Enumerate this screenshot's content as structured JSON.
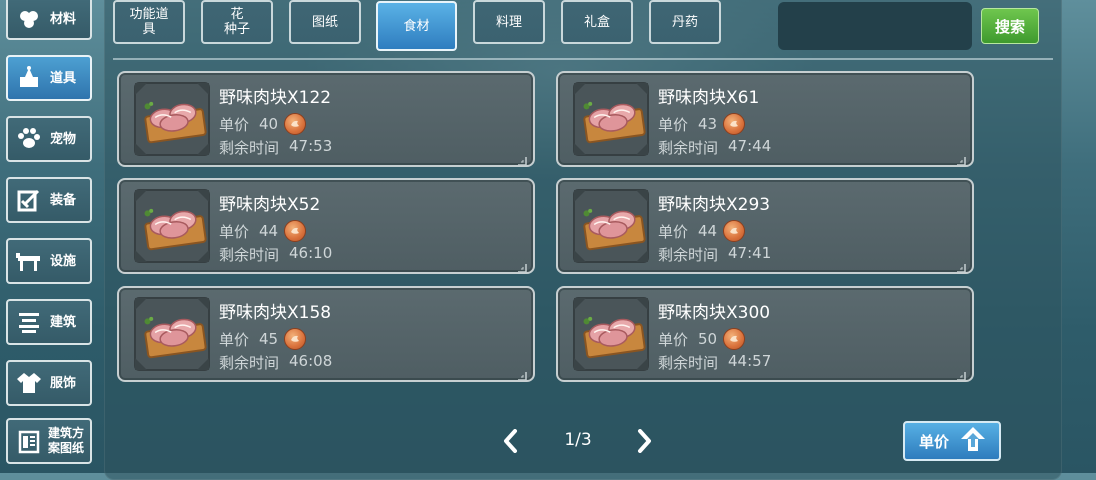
{
  "sidebar": {
    "items": [
      {
        "label": "材料",
        "icon": "materials-icon"
      },
      {
        "label": "道具",
        "icon": "props-icon",
        "active": true
      },
      {
        "label": "宠物",
        "icon": "paw-icon"
      },
      {
        "label": "装备",
        "icon": "equipment-icon"
      },
      {
        "label": "设施",
        "icon": "facility-icon"
      },
      {
        "label": "建筑",
        "icon": "building-icon"
      },
      {
        "label": "服饰",
        "icon": "clothing-icon"
      },
      {
        "label": "建筑方案图纸",
        "label_line1": "建筑方",
        "label_line2": "案图纸",
        "icon": "blueprint-icon"
      }
    ]
  },
  "tabs": [
    {
      "line1": "功能道",
      "line2": "具"
    },
    {
      "line1": "花",
      "line2": "种子"
    },
    {
      "line1": "图纸",
      "line2": ""
    },
    {
      "line1": "食材",
      "line2": "",
      "active": true
    },
    {
      "line1": "料理",
      "line2": ""
    },
    {
      "line1": "礼盒",
      "line2": ""
    },
    {
      "line1": "丹药",
      "line2": ""
    }
  ],
  "search": {
    "button_label": "搜索",
    "value": ""
  },
  "labels": {
    "price": "单价",
    "remaining": "剩余时间"
  },
  "items": [
    {
      "name": "野味肉块X122",
      "price": "40",
      "time": "47:53"
    },
    {
      "name": "野味肉块X61",
      "price": "43",
      "time": "47:44"
    },
    {
      "name": "野味肉块X52",
      "price": "44",
      "time": "46:10"
    },
    {
      "name": "野味肉块X293",
      "price": "44",
      "time": "47:41"
    },
    {
      "name": "野味肉块X158",
      "price": "45",
      "time": "46:08"
    },
    {
      "name": "野味肉块X300",
      "price": "50",
      "time": "44:57"
    }
  ],
  "pager": {
    "text": "1/3"
  },
  "sort": {
    "label": "单价"
  },
  "colors": {
    "accent": "#3a8fd0",
    "search": "#4fae3a",
    "coin": "#d9713b"
  }
}
